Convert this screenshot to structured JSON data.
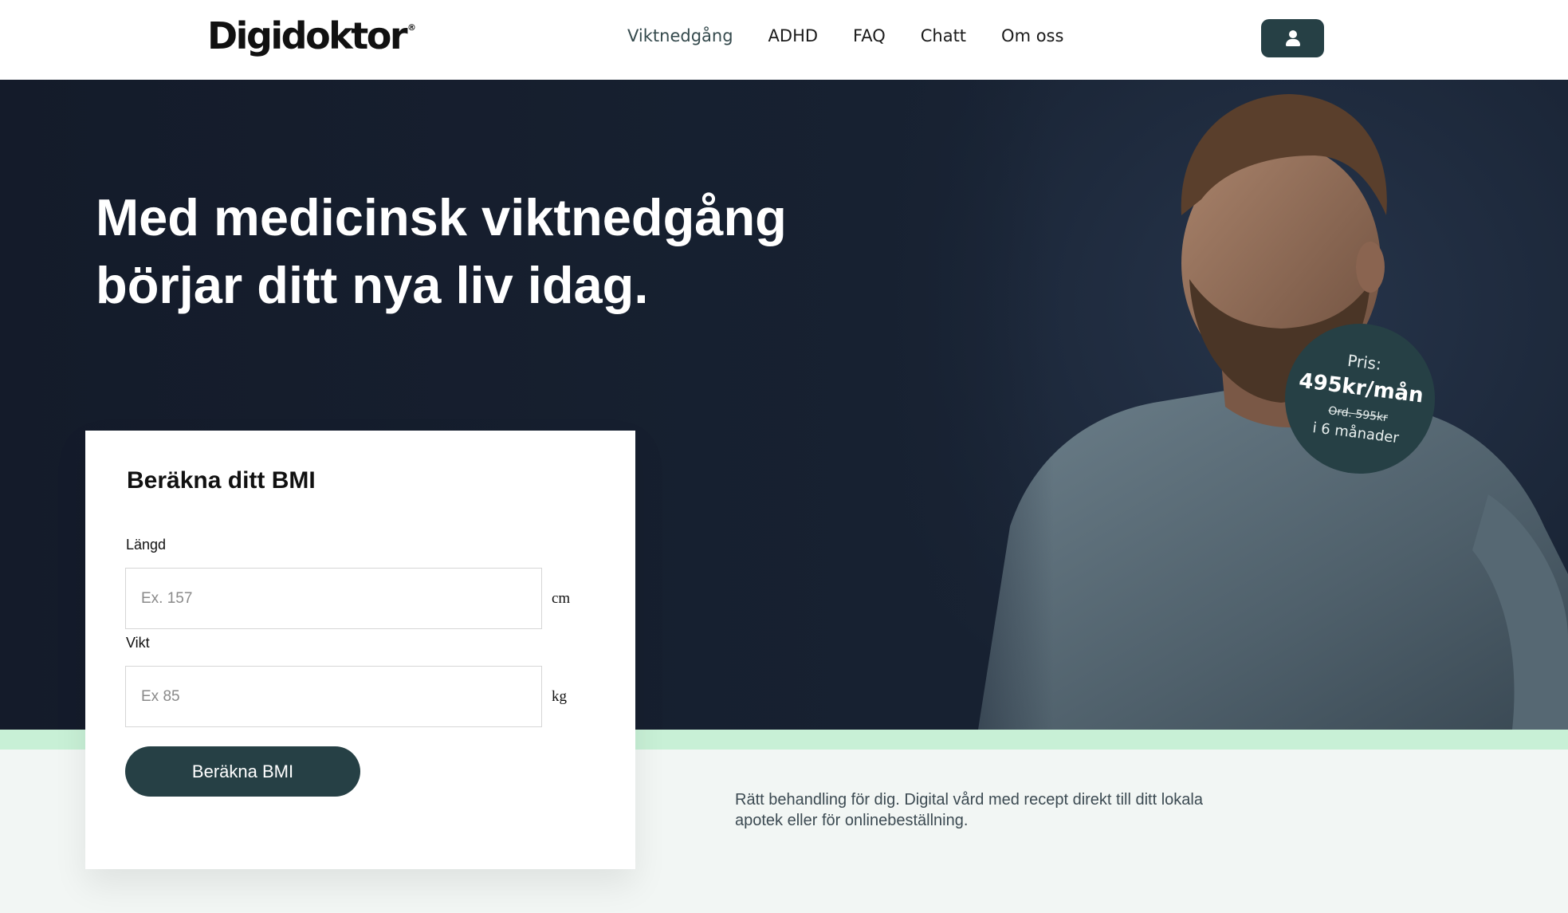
{
  "header": {
    "logo_text": "Digidoktor",
    "logo_mark": "®",
    "nav": [
      {
        "label": "Viktnedgång"
      },
      {
        "label": "ADHD"
      },
      {
        "label": "FAQ"
      },
      {
        "label": "Chatt"
      },
      {
        "label": "Om oss"
      }
    ],
    "account_icon": "user-icon"
  },
  "hero": {
    "headline": "Med medicinsk viktnedgång börjar ditt nya liv idag.",
    "price_badge": {
      "label": "Pris:",
      "price": "495kr/mån",
      "original": "Ord. 595kr",
      "duration": "i 6 månader"
    }
  },
  "bmi": {
    "title": "Beräkna ditt BMI",
    "height_label": "Längd",
    "height_placeholder": "Ex. 157",
    "height_value": "",
    "height_unit": "cm",
    "weight_label": "Vikt",
    "weight_placeholder": "Ex 85",
    "weight_value": "",
    "weight_unit": "kg",
    "button_label": "Beräkna BMI"
  },
  "tagline": "Rätt behandling för dig. Digital vård med recept direkt till ditt lokala apotek eller för onlinebeställning.",
  "colors": {
    "brand_dark": "#264045",
    "hero_bg": "#141b2a",
    "accent_green": "#c8f0d6",
    "page_bg": "#f2f6f4"
  }
}
